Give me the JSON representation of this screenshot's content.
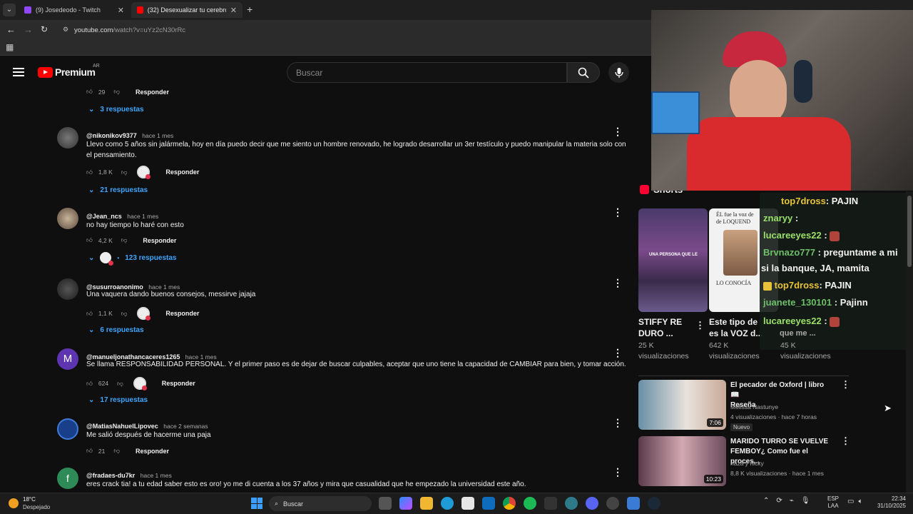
{
  "browser": {
    "tabs": [
      {
        "label": "(9) Josedeodo - Twitch"
      },
      {
        "label": "(32) Desexualizar tu cerebro en"
      }
    ],
    "url_host": "youtube.com",
    "url_path": "/watch?v=uYz2cN30rRc"
  },
  "youtube": {
    "logo_text": "Premium",
    "region": "AR",
    "search_placeholder": "Buscar"
  },
  "comments": [
    {
      "likes": "29",
      "reply_label": "Responder",
      "replies": "3 respuestas"
    },
    {
      "user": "@nikonikov9377",
      "ago": "hace 1 mes",
      "text": "Llevo como 5 años sin jalármela, hoy en día puedo decir que me siento un hombre renovado, he logrado desarrollar un 3er testículo y puedo manipular la materia solo con el pensamiento.",
      "likes": "1,8 K",
      "reply_label": "Responder",
      "replies": "21 respuestas"
    },
    {
      "user": "@Jean_ncs",
      "ago": "hace 1 mes",
      "text": "no hay tiempo lo haré con esto",
      "likes": "4,2 K",
      "reply_label": "Responder",
      "replies": "123 respuestas"
    },
    {
      "user": "@susurroanonimo",
      "ago": "hace 1 mes",
      "text": "Una vaquera dando buenos consejos, messirve jajaja",
      "likes": "1,1 K",
      "reply_label": "Responder",
      "replies": "6 respuestas"
    },
    {
      "user": "@manueljonathancaceres1265",
      "ago": "hace 1 mes",
      "avatar_letter": "M",
      "text": "Se llama RESPONSABILIDAD PERSONAL. Y el primer paso es de dejar de buscar culpables, aceptar que uno tiene la capacidad de CAMBIAR para bien, y tomar acción.",
      "likes": "624",
      "reply_label": "Responder",
      "replies": "17 respuestas"
    },
    {
      "user": "@MatiasNahuelLipovec",
      "ago": "hace 2 semanas",
      "text": "Me salió después de hacerme una paja",
      "likes": "21",
      "reply_label": "Responder"
    },
    {
      "user": "@fradaes-du7kr",
      "ago": "hace 1 mes",
      "avatar_letter": "f",
      "text": "eres crack tia! a tu edad saber esto es oro! yo me di cuenta a los 37 años y mira que casualidad que he empezado la universidad este año."
    }
  ],
  "shorts": {
    "section_label": "Shorts",
    "items": [
      {
        "title_1": "STIFFY RE",
        "title_2": "DURO ...",
        "views_1": "25 K",
        "views_2": "visualizaciones",
        "overlay": "UNA PERSONA QUE LE"
      },
      {
        "title_1": "Este tipo de",
        "title_2": "es la VOZ d...",
        "views_1": "642 K",
        "views_2": "visualizaciones",
        "overlay_top": "ÉL fue la voz de",
        "overlay_top2": "de LOQUEND",
        "overlay_bottom": "LO CONOCÍA"
      },
      {
        "title_2": "que me ...",
        "views_1": "45 K",
        "views_2": "visualizaciones"
      }
    ]
  },
  "chat": [
    {
      "user": "top7dross",
      "msg": ": PAJIN",
      "color": "#e8c33a"
    },
    {
      "user": "znaryy",
      "msg": ":",
      "color": "#9ae06a"
    },
    {
      "user": "lucareeyes22",
      "msg": ":",
      "color": "#9ae06a"
    },
    {
      "user": "Brvnazo777",
      "msg": ": preguntame a mi",
      "color": "#6fbf6a"
    },
    {
      "user": "",
      "msg": "si la banque, JA, mamita",
      "color": "#ffffff"
    },
    {
      "user": "top7dross",
      "msg": ": PAJIN",
      "color": "#e8c33a"
    },
    {
      "user": "juanete_130101",
      "msg": ": Pajinn",
      "color": "#6fbf6a"
    },
    {
      "user": "lucareeyes22",
      "msg": ":",
      "color": "#9ae06a"
    }
  ],
  "videos": [
    {
      "title_1": "El pecador de Oxford | libro 📖",
      "title_2": "Reseña",
      "channel": "Melissa Nastunye",
      "meta": "4 visualizaciones · hace 7 horas",
      "badge": "Nuevo",
      "duration": "7:06"
    },
    {
      "title_1": "MARIDO TURRO SE VUELVE",
      "title_2": "FEMBOY¿ Como fue el proces...",
      "channel": "naza y nicky",
      "meta": "8,8 K visualizaciones · hace 1 mes",
      "duration": "10:23"
    }
  ],
  "taskbar": {
    "weather_temp": "18°C",
    "weather_desc": "Despejado",
    "search_label": "Buscar",
    "lang_1": "ESP",
    "lang_2": "LAA",
    "time": "22:34",
    "date": "31/10/2025"
  },
  "colors": {
    "accent_blue": "#3ea6ff",
    "youtube_red": "#ff0000",
    "bg": "#0f0f0f"
  }
}
